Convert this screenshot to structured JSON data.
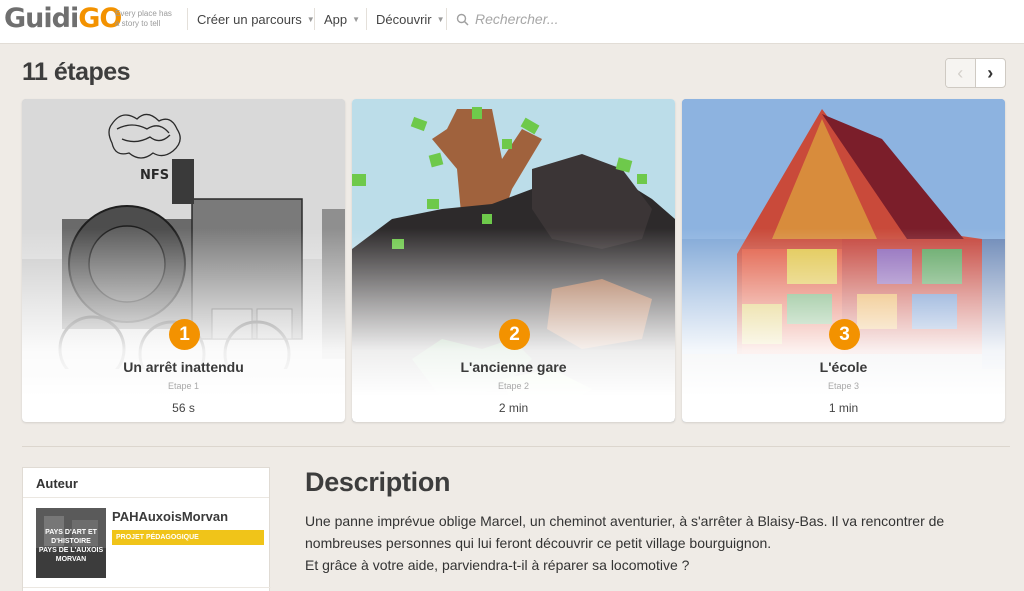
{
  "header": {
    "logo_text": [
      "Guidi",
      "GO"
    ],
    "tagline": [
      "Every place has",
      "a story to tell"
    ],
    "nav": [
      {
        "label": "Créer un parcours",
        "has_dropdown": true
      },
      {
        "label": "App",
        "has_dropdown": true
      },
      {
        "label": "Découvrir",
        "has_dropdown": true
      }
    ],
    "search": {
      "placeholder": "Rechercher...",
      "icon": "search-icon"
    }
  },
  "steps": {
    "title": "11 étapes",
    "pager": {
      "prev_icon": "chevron-left-icon",
      "next_icon": "chevron-right-icon"
    },
    "cards": [
      {
        "number": "1",
        "title": "Un arrêt inattendu",
        "label": "Etape 1",
        "duration": "56 s"
      },
      {
        "number": "2",
        "title": "L'ancienne gare",
        "label": "Etape 2",
        "duration": "2 min"
      },
      {
        "number": "3",
        "title": "L'école",
        "label": "Etape 3",
        "duration": "1 min"
      }
    ]
  },
  "author": {
    "heading": "Auteur",
    "name": "PAHAuxoisMorvan",
    "badge": "PROJET PÉDAGOGIQUE",
    "avatar_text": [
      "PAYS D'ART ET",
      "D'HISTOIRE",
      "PAYS DE L'AUXOIS",
      "MORVAN"
    ]
  },
  "description": {
    "heading": "Description",
    "lines": [
      "Une panne imprévue oblige Marcel, un cheminot aventurier, à s'arrêter à Blaisy-Bas. Il va rencontrer de",
      "nombreuses personnes qui lui feront découvrir ce petit village bourguignon.",
      "Et grâce à votre aide, parviendra-t-il à réparer sa locomotive ?"
    ]
  },
  "colors": {
    "accent": "#f39200",
    "badge": "#f0c419",
    "background": "#efebe6"
  }
}
